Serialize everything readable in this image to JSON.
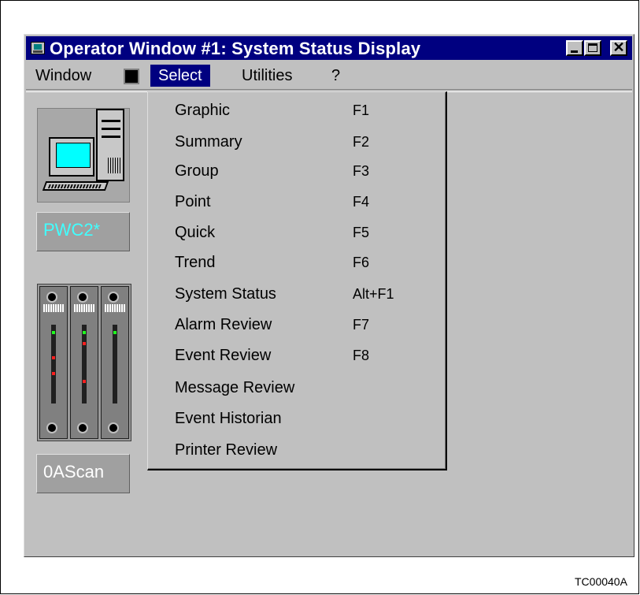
{
  "window": {
    "title": "Operator Window #1: System Status Display"
  },
  "menubar": {
    "window": "Window",
    "select": "Select",
    "utilities": "Utilities",
    "help": "?"
  },
  "dropdown": {
    "items": [
      {
        "label": "Graphic",
        "key": "F1"
      },
      {
        "label": "Summary",
        "key": "F2"
      },
      {
        "label": "Group",
        "key": "F3"
      },
      {
        "label": "Point",
        "key": "F4"
      },
      {
        "label": "Quick",
        "key": "F5"
      },
      {
        "label": "Trend",
        "key": "F6"
      },
      {
        "label": "System Status",
        "key": "Alt+F1"
      },
      {
        "label": "Alarm Review",
        "key": "F7"
      },
      {
        "label": "Event Review",
        "key": "F8"
      },
      {
        "label": "Message Review",
        "key": ""
      },
      {
        "label": "Event Historian",
        "key": ""
      },
      {
        "label": "Printer Review",
        "key": ""
      }
    ]
  },
  "nodes": {
    "workstation_label": "PWC2*",
    "rack_label": "0AScan"
  },
  "colors": {
    "titlebar": "#000080",
    "window_bg": "#c0c0c0",
    "workstation_label_text": "#40ffff",
    "monitor_screen": "#00ffff"
  },
  "caption": "TC00040A"
}
